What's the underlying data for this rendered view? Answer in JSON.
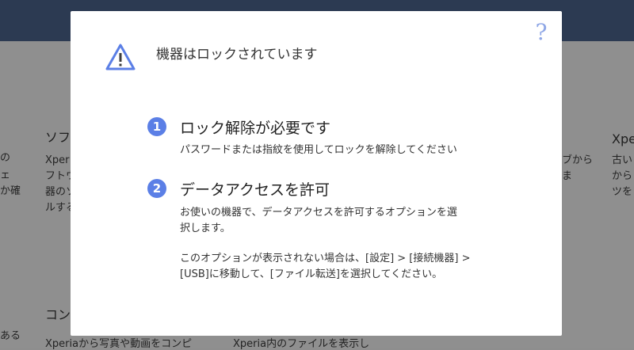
{
  "background": {
    "col1_lines": [
      "の",
      "ェ",
      "か確"
    ],
    "col2_title": "ソフ",
    "col2_lines": [
      "Xper",
      "フトウ",
      "器のソ",
      "ルする"
    ],
    "col3_lines": [
      "ブから",
      "ま"
    ],
    "col4_title": "Xpe",
    "col4_lines": [
      "古い",
      "から",
      "ツを"
    ],
    "bottom_left": "ある",
    "bottom_title": "コン",
    "bottom_line1": "Xperiaから写真や動画をコンピ",
    "bottom_line2": "Xperia内のファイルを表示し"
  },
  "modal": {
    "help_icon_glyph": "?",
    "title": "機器はロックされています",
    "steps": [
      {
        "number": "1",
        "title": "ロック解除が必要です",
        "lines": [
          "パスワードまたは指紋を使用してロックを解除してください"
        ]
      },
      {
        "number": "2",
        "title": "データアクセスを許可",
        "lines": [
          "お使いの機器で、データアクセスを許可するオプションを選",
          "択します。",
          "このオプションが表示されない場合は、[設定] > [接続機器] >",
          "[USB]に移動して、[ファイル転送]を選択してください。"
        ]
      }
    ]
  },
  "colors": {
    "accent": "#5b7fe6",
    "warning_icon": "#5b7fe6",
    "help_icon": "#8fa7e6",
    "overlay": "#8f8f8f",
    "header": "#2c3a52"
  }
}
